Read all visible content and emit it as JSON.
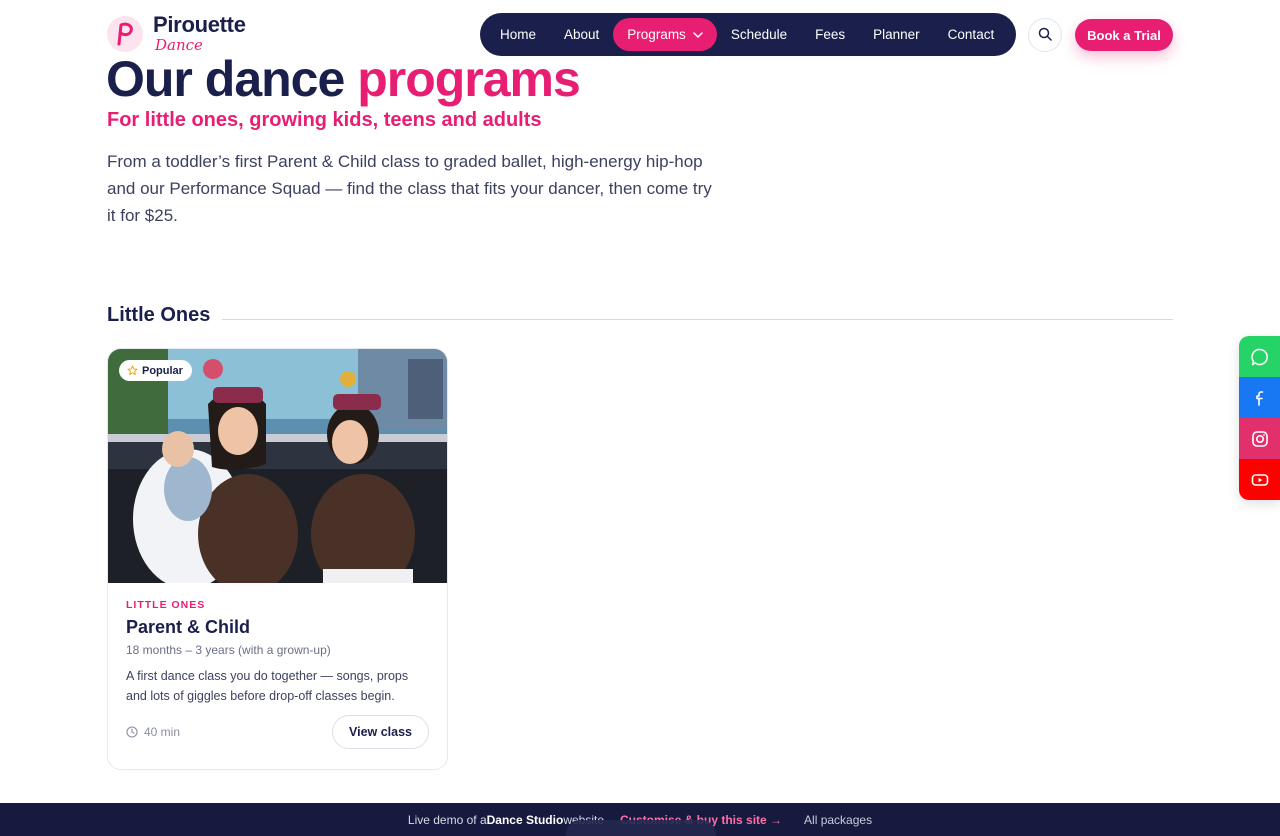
{
  "brand": {
    "name": "Pirouette",
    "tagline": "Dance"
  },
  "nav": {
    "items": [
      {
        "label": "Home"
      },
      {
        "label": "About"
      },
      {
        "label": "Programs",
        "active": true
      },
      {
        "label": "Schedule"
      },
      {
        "label": "Fees"
      },
      {
        "label": "Planner"
      },
      {
        "label": "Contact"
      }
    ],
    "search_icon": "search-icon",
    "cta_label": "Book a Trial"
  },
  "hero": {
    "title_main": "Our dance ",
    "title_accent": "programs",
    "subtitle": "For little ones, growing kids, teens and adults",
    "description": "From a toddler’s first Parent & Child class to graded ballet, high-energy hip-hop and our Performance Squad — find the class that fits your dancer, then come try it for $25."
  },
  "sections": [
    {
      "title": "Little Ones",
      "cards": [
        {
          "badge": "Popular",
          "category": "LITTLE ONES",
          "title": "Parent & Child",
          "age": "18 months – 3 years (with a grown-up)",
          "description": "A first dance class you do together — songs, props and lots of giggles before drop-off classes begin.",
          "duration": "40 min",
          "button": "View class"
        }
      ]
    }
  ],
  "social": [
    "whatsapp-icon",
    "facebook-icon",
    "instagram-icon",
    "youtube-icon"
  ],
  "demo_bar": {
    "prefix": "Live demo of a ",
    "bold": "Dance Studio",
    "suffix": " website",
    "link": "Customise & buy this site →",
    "packages": "All packages"
  },
  "colors": {
    "navy": "#1a1f4b",
    "pink": "#e81e73",
    "whatsapp": "#25d366",
    "facebook": "#1877f2",
    "instagram": "#e1306c",
    "youtube": "#ff0000"
  }
}
